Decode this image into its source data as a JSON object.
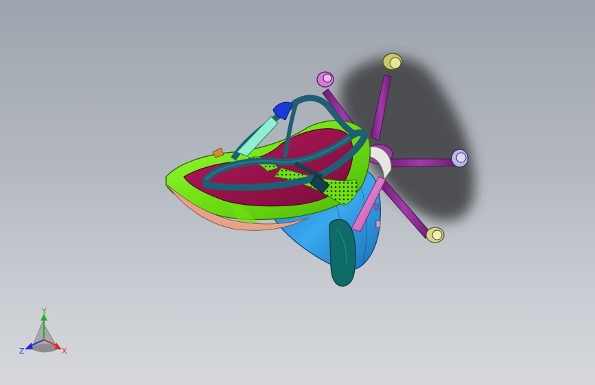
{
  "viewport": {
    "background_top": "#9ea4ad",
    "background_bottom": "#d6d8dc"
  },
  "model": {
    "description_visible": false,
    "colors": {
      "seat_rim": "#7cf01a",
      "seat_pad": "#a0124e",
      "backrest_frame": "#1f5f73",
      "base_shell": "#2f9be0",
      "legs": "#8a2a92",
      "armrest": "#e06fc6",
      "armpad": "#0f6b68",
      "casters": "#d9d98a",
      "shadow": "#3c3c40"
    }
  },
  "triad": {
    "x_label": "X",
    "y_label": "Y",
    "z_label": "Z",
    "x_color": "#d42a2a",
    "y_color": "#1db51d",
    "z_color": "#2a2ad4"
  }
}
